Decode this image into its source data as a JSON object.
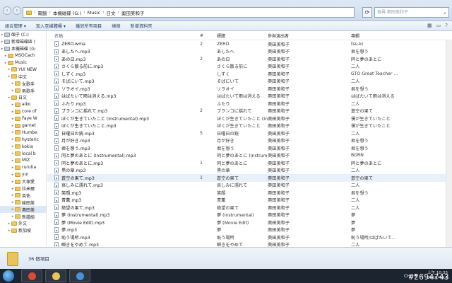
{
  "address": {
    "segments": [
      "電腦",
      "本機磁碟 (G:)",
      "Music",
      "日文",
      "奧田美和子"
    ],
    "search_placeholder": "搜尋 奧田美和子"
  },
  "toolbar": {
    "items": [
      "組合管理 ▾",
      "加入至媒體櫃 ▾",
      "播放所有項目",
      "燒錄",
      "新增資料夾"
    ]
  },
  "sidebar": {
    "items": [
      {
        "label": "碩子 (C:)",
        "icon": "drive-icon",
        "indent": 1
      },
      {
        "label": "新增磁碟區 (",
        "icon": "drive-icon",
        "indent": 1
      },
      {
        "label": "本機磁碟 (G:",
        "icon": "drive-icon",
        "indent": 1
      },
      {
        "label": "MSOCach",
        "icon": "folder-icon",
        "indent": 2
      },
      {
        "label": "Music",
        "icon": "folder-icon",
        "indent": 2
      },
      {
        "label": "YUI NEW",
        "icon": "folder-icon",
        "indent": 3
      },
      {
        "label": "中文",
        "icon": "folder-icon",
        "indent": 3
      },
      {
        "label": "女歌手",
        "icon": "folder-icon",
        "indent": 4
      },
      {
        "label": "男歌手",
        "icon": "folder-icon",
        "indent": 4
      },
      {
        "label": "日文",
        "icon": "folder-icon",
        "indent": 3
      },
      {
        "label": "aiko",
        "icon": "folder-icon",
        "indent": 4
      },
      {
        "label": "core of",
        "icon": "folder-icon",
        "indent": 4
      },
      {
        "label": "Faye W",
        "icon": "folder-icon",
        "indent": 4
      },
      {
        "label": "garnet",
        "icon": "folder-icon",
        "indent": 4
      },
      {
        "label": "Humbe",
        "icon": "folder-icon",
        "indent": 4
      },
      {
        "label": "hysteric",
        "icon": "folder-icon",
        "indent": 4
      },
      {
        "label": "kokia",
        "icon": "folder-icon",
        "indent": 4
      },
      {
        "label": "local b",
        "icon": "folder-icon",
        "indent": 4
      },
      {
        "label": "MIZ",
        "icon": "folder-icon",
        "indent": 4
      },
      {
        "label": "rurutia",
        "icon": "folder-icon",
        "indent": 4
      },
      {
        "label": "yui",
        "icon": "folder-icon",
        "indent": 4
      },
      {
        "label": "大塚愛",
        "icon": "folder-icon",
        "indent": 4
      },
      {
        "label": "拉米爾",
        "icon": "folder-icon",
        "indent": 4
      },
      {
        "label": "英佑",
        "icon": "folder-icon",
        "indent": 4
      },
      {
        "label": "綾田美",
        "icon": "folder-icon",
        "indent": 4
      },
      {
        "label": "奧田美",
        "icon": "folder-icon",
        "indent": 4,
        "selected": true
      },
      {
        "label": "新譜組",
        "icon": "folder-icon",
        "indent": 4
      },
      {
        "label": "外文",
        "icon": "folder-icon",
        "indent": 3
      },
      {
        "label": "新加坡",
        "icon": "folder-icon",
        "indent": 3
      }
    ]
  },
  "list": {
    "headers": {
      "name": "名稱",
      "num": "#",
      "title": "標題",
      "artist": "參與演出者",
      "album": "專輯"
    },
    "rows": [
      {
        "name": "ZERO.wma",
        "num": "2",
        "title": "ZERO",
        "artist": "奧田美和子",
        "album": "tsu-ki",
        "type": "wma"
      },
      {
        "name": "あしたへ.mp3",
        "num": "",
        "title": "あしたへ",
        "artist": "奧田美和子",
        "album": "君を想う",
        "type": "mp3"
      },
      {
        "name": "あの日.mp3",
        "num": "2",
        "title": "あの日",
        "artist": "奧田美和子",
        "album": "同と夢のあとに",
        "type": "mp3"
      },
      {
        "name": "さくら散る前に.mp3",
        "num": "",
        "title": "さくら散る前に",
        "artist": "奧田美和子",
        "album": "二人",
        "type": "mp3"
      },
      {
        "name": "しずく.mp3",
        "num": "",
        "title": "しずく",
        "artist": "奧田美和子",
        "album": "GTO Great Teacher ...",
        "type": "mp3"
      },
      {
        "name": "そばにいて.mp3",
        "num": "",
        "title": "そばにいて",
        "artist": "奧田美和子",
        "album": "二人",
        "type": "mp3"
      },
      {
        "name": "ソラオイ.mp3",
        "num": "",
        "title": "ソラオイ",
        "artist": "奧田美和子",
        "album": "君を想う",
        "type": "mp3"
      },
      {
        "name": "はばたいて雨は消える.mp3",
        "num": "",
        "title": "はばたいて雨は消える",
        "artist": "奧田美和子",
        "album": "はばたいて雨は消える",
        "type": "mp3"
      },
      {
        "name": "ふたり.mp3",
        "num": "",
        "title": "ふたり",
        "artist": "奧田美和子",
        "album": "二人",
        "type": "mp3"
      },
      {
        "name": "ブランコに揺れて.mp3",
        "num": "2",
        "title": "ブランコに揺れて",
        "artist": "奧田美和子",
        "album": "蒼空の果て",
        "type": "mp3"
      },
      {
        "name": "ぼくが生きていたこと (Instrumental).mp3",
        "num": "",
        "title": "ぼくが生きていたこと (In...",
        "artist": "奧田美和子",
        "album": "僕が生きていたこと",
        "type": "mp3"
      },
      {
        "name": "ぼくが生きていたこと.mp3",
        "num": "",
        "title": "ぼくが生きていたこと",
        "artist": "奧田美和子",
        "album": "僕が生きていたこと",
        "type": "mp3"
      },
      {
        "name": "日曜日の銃.mp3",
        "num": "5",
        "title": "日曜日の銃",
        "artist": "奧田美和子",
        "album": "二人",
        "type": "mp3"
      },
      {
        "name": "月が好き.mp3",
        "num": "",
        "title": "月が好き",
        "artist": "奧田美和子",
        "album": "君を想う",
        "type": "mp3"
      },
      {
        "name": "君を想う.mp3",
        "num": "",
        "title": "君を想う",
        "artist": "奧田美和子",
        "album": "君を想う",
        "type": "mp3"
      },
      {
        "name": "同と夢のあとに (Instrumental).mp3",
        "num": "",
        "title": "同と夢のあとに (Instrumen...",
        "artist": "奧田美和子",
        "album": "BORN",
        "type": "mp3"
      },
      {
        "name": "同と夢のあとに.mp3",
        "num": "1",
        "title": "同と夢のあとに",
        "artist": "奧田美和子",
        "album": "同と夢のあとに",
        "type": "mp3"
      },
      {
        "name": "黒の章.mp3",
        "num": "",
        "title": "黒の章",
        "artist": "奧田美和子",
        "album": "二人",
        "type": "mp3"
      },
      {
        "name": "蒼空の果て.mp3",
        "num": "1",
        "title": "蒼空の果て",
        "artist": "奧田美和子",
        "album": "蒼空の果て",
        "type": "mp3",
        "selected": true
      },
      {
        "name": "哀しみに濡れて.mp3",
        "num": "",
        "title": "哀しみに濡れて",
        "artist": "奧田美和子",
        "album": "二人",
        "type": "mp3"
      },
      {
        "name": "笑顔.mp3",
        "num": "",
        "title": "笑顔",
        "artist": "奧田美和子",
        "album": "君を想う",
        "type": "mp3"
      },
      {
        "name": "青薫.mp3",
        "num": "",
        "title": "青薫",
        "artist": "奧田美和子",
        "album": "二人",
        "type": "mp3"
      },
      {
        "name": "絶望の果て.mp3",
        "num": "",
        "title": "絶望の果て",
        "artist": "奧田美和子",
        "album": "二人",
        "type": "mp3"
      },
      {
        "name": "夢 (Instrumental).mp3",
        "num": "",
        "title": "夢 (Instrumental)",
        "artist": "奧田美和子",
        "album": "夢",
        "type": "mp3"
      },
      {
        "name": "夢 (Movie Edit).mp3",
        "num": "",
        "title": "夢 (Movie Edit)",
        "artist": "奧田美和子",
        "album": "夢",
        "type": "mp3"
      },
      {
        "name": "夢.mp3",
        "num": "",
        "title": "夢",
        "artist": "奧田美和子",
        "album": "夢",
        "type": "mp3"
      },
      {
        "name": "恥う場所.mp3",
        "num": "",
        "title": "恥う場所",
        "artist": "奧田美和子",
        "album": "恥う場所/はばたいて...",
        "type": "mp3"
      },
      {
        "name": "瞬きをやめて.mp3",
        "num": "",
        "title": "瞬きをやめて",
        "artist": "奧田美和子",
        "album": "二人",
        "type": "mp3"
      }
    ]
  },
  "details": {
    "count": "36 個項目"
  },
  "taskbar": {
    "apps": [
      {
        "name": "chrome-app",
        "color": "#d84a3a"
      },
      {
        "name": "explorer-app",
        "color": "#e8c45d"
      },
      {
        "name": "media-player-app",
        "color": "#4a8fd8"
      }
    ],
    "tray": {
      "lang": "CH",
      "time": "上午 10:33",
      "date": "2010/4/14"
    }
  },
  "watermark": "#2694743"
}
